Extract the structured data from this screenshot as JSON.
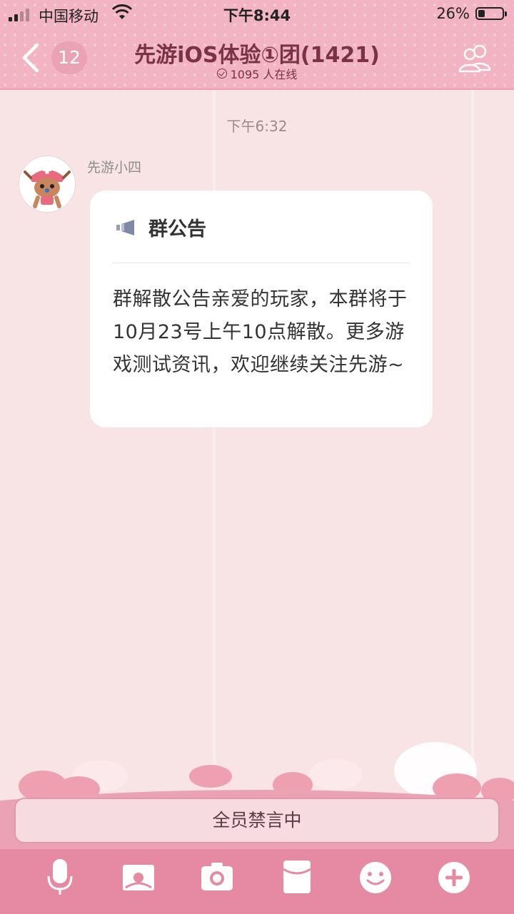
{
  "status_bar": {
    "carrier": "中国移动",
    "time": "下午8:44",
    "battery": "26%",
    "battery_level": 0.26
  },
  "header": {
    "unread_count": "12",
    "title": "先游iOS体验①团(1421)",
    "online_text": "1095 人在线",
    "icons": [
      "chevron-left-icon",
      "members-icon",
      "check-circle-icon"
    ]
  },
  "chat": {
    "timestamp": "下午6:32",
    "message": {
      "sender": "先游小四",
      "card_title": "群公告",
      "card_body": "群解散公告亲爱的玩家，本群将于10月23号上午10点解散。更多游戏测试资讯，欢迎继续关注先游~",
      "card_icon": "megaphone-icon"
    }
  },
  "input": {
    "muted_text": "全员禁言中"
  },
  "toolbar_icons": [
    "microphone-icon",
    "image-icon",
    "camera-icon",
    "red-packet-icon",
    "emoji-icon",
    "plus-icon"
  ],
  "colors": {
    "header_pink": "#f2b3c3",
    "accent": "#e58aa2",
    "title_text": "#7a3346"
  }
}
